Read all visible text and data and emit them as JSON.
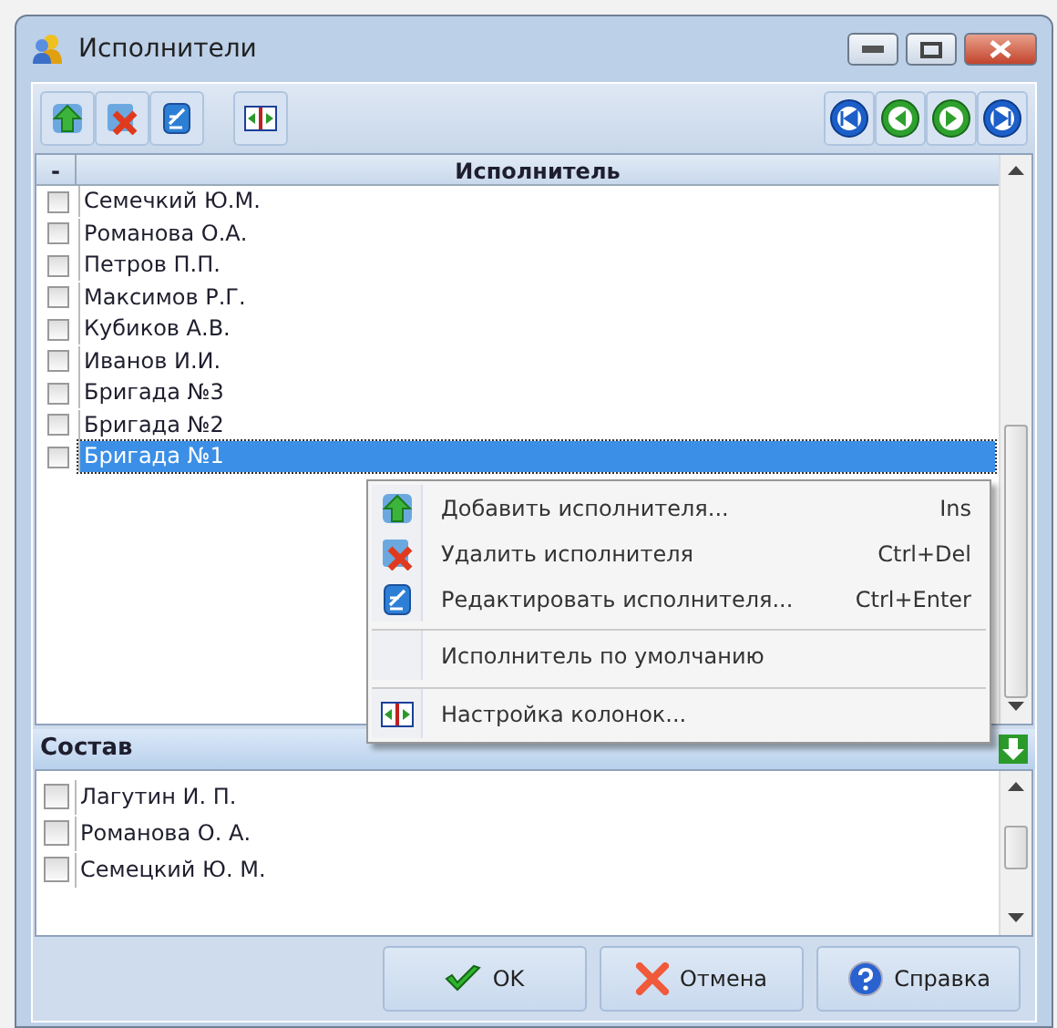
{
  "window": {
    "title": "Исполнители"
  },
  "toolbar": {
    "left": [
      {
        "kind": "add"
      },
      {
        "kind": "delete"
      },
      {
        "kind": "edit"
      },
      {
        "kind": "columns"
      }
    ],
    "right": [
      {
        "kind": "first"
      },
      {
        "kind": "prev"
      },
      {
        "kind": "next"
      },
      {
        "kind": "last"
      }
    ]
  },
  "grid": {
    "columns": [
      "-",
      "Исполнитель"
    ],
    "rows": [
      {
        "name": "Семечкий Ю.М.",
        "checked": false,
        "selected": false
      },
      {
        "name": "Романова О.А.",
        "checked": false,
        "selected": false
      },
      {
        "name": "Петров П.П.",
        "checked": false,
        "selected": false
      },
      {
        "name": "Максимов Р.Г.",
        "checked": false,
        "selected": false
      },
      {
        "name": "Кубиков А.В.",
        "checked": false,
        "selected": false
      },
      {
        "name": "Иванов И.И.",
        "checked": false,
        "selected": false
      },
      {
        "name": "Бригада №3",
        "checked": false,
        "selected": false
      },
      {
        "name": "Бригада №2",
        "checked": false,
        "selected": false
      },
      {
        "name": "Бригада №1",
        "checked": false,
        "selected": true
      }
    ]
  },
  "context_menu": [
    {
      "kind": "add",
      "label": "Добавить исполнителя...",
      "shortcut": "Ins",
      "separated": false
    },
    {
      "kind": "delete",
      "label": "Удалить исполнителя",
      "shortcut": "Ctrl+Del",
      "separated": false
    },
    {
      "kind": "edit",
      "label": "Редактировать исполнителя...",
      "shortcut": "Ctrl+Enter",
      "separated": false
    },
    {
      "kind": "none",
      "label": "Исполнитель по умолчанию",
      "separated": true
    },
    {
      "kind": "columns",
      "label": "Настройка колонок...",
      "separated": true
    }
  ],
  "composition": {
    "title": "Состав",
    "items": [
      {
        "name": "Лагутин И. П.",
        "checked": false
      },
      {
        "name": "Романова О. А.",
        "checked": false
      },
      {
        "name": "Семецкий Ю. М.",
        "checked": false
      }
    ]
  },
  "buttons": [
    {
      "kind": "ok",
      "label": "OK"
    },
    {
      "kind": "cancel",
      "label": "Отмена"
    },
    {
      "kind": "help",
      "label": "Справка"
    }
  ]
}
